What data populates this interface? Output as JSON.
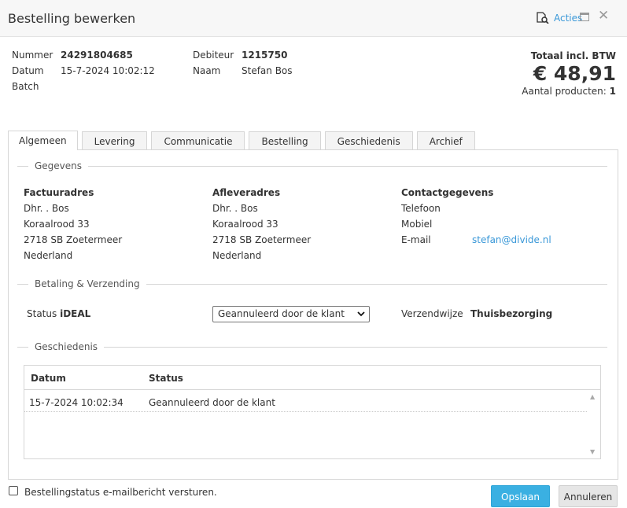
{
  "dialog": {
    "title": "Bestelling bewerken",
    "acties_label": "Acties",
    "close_glyph": "✕"
  },
  "order": {
    "nummer_label": "Nummer",
    "nummer_value": "24291804685",
    "datum_label": "Datum",
    "datum_value": "15-7-2024 10:02:12",
    "batch_label": "Batch",
    "debiteur_label": "Debiteur",
    "debiteur_value": "1215750",
    "naam_label": "Naam",
    "naam_value": "Stefan Bos"
  },
  "totals": {
    "label": "Totaal incl. BTW",
    "amount": "€ 48,91",
    "aantal_label": "Aantal producten:",
    "aantal_value": "1"
  },
  "tabs": [
    {
      "label": "Algemeen",
      "active": true
    },
    {
      "label": "Levering"
    },
    {
      "label": "Communicatie"
    },
    {
      "label": "Bestelling"
    },
    {
      "label": "Geschiedenis"
    },
    {
      "label": "Archief"
    }
  ],
  "gegevens": {
    "section_label": "Gegevens",
    "factuur": {
      "heading": "Factuuradres",
      "lines": [
        "Dhr. . Bos",
        "Koraalrood 33",
        "2718 SB Zoetermeer",
        "Nederland"
      ]
    },
    "aflever": {
      "heading": "Afleveradres",
      "lines": [
        "Dhr. . Bos",
        "Koraalrood 33",
        "2718 SB Zoetermeer",
        "Nederland"
      ]
    },
    "contact": {
      "heading": "Contactgegevens",
      "telefoon_label": "Telefoon",
      "mobiel_label": "Mobiel",
      "email_label": "E-mail",
      "email_value": "stefan@divide.nl"
    }
  },
  "betaling": {
    "section_label": "Betaling & Verzending",
    "status_label": "Status",
    "status_method": "iDEAL",
    "status_selected": "Geannuleerd door de klant",
    "verzendwijze_label": "Verzendwijze",
    "verzendwijze_value": "Thuisbezorging"
  },
  "geschiedenis": {
    "section_label": "Geschiedenis",
    "columns": [
      "Datum",
      "Status"
    ],
    "rows": [
      {
        "datum": "15-7-2024 10:02:34",
        "status": "Geannuleerd door de klant"
      }
    ]
  },
  "footer": {
    "checkbox_label": "Bestellingstatus e-mailbericht versturen.",
    "save_label": "Opslaan",
    "cancel_label": "Annuleren"
  }
}
